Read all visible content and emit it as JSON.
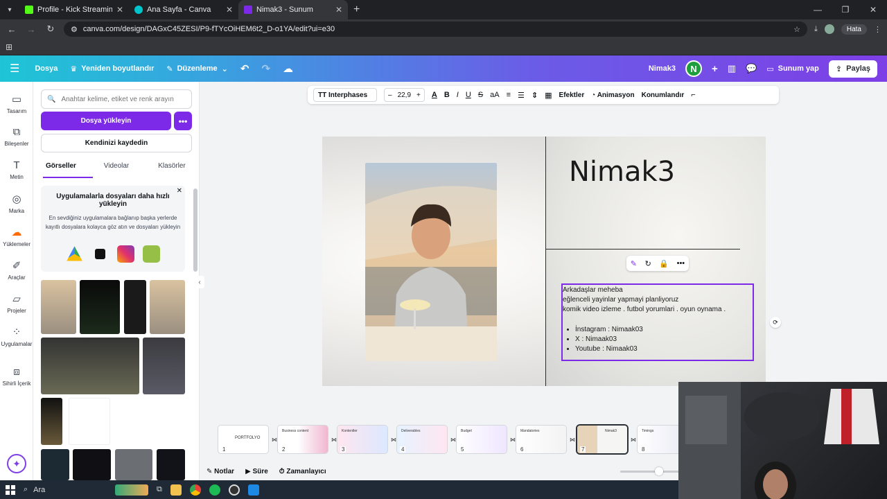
{
  "browser": {
    "tabs": [
      {
        "title": "Profile - Kick Streaming",
        "color": "#53fc18"
      },
      {
        "title": "Ana Sayfa - Canva",
        "color": "#00c4cc"
      },
      {
        "title": "Nimak3 - Sunum",
        "color": "#7d2ae8"
      }
    ],
    "url": "canva.com/design/DAGxC45ZESI/P9-fTYcOiHEM6t2_D-o1YA/edit?ui=e30",
    "error_label": "Hata"
  },
  "header": {
    "file": "Dosya",
    "resize": "Yeniden boyutlandır",
    "edit": "Düzenleme",
    "doc_name": "Nimak3",
    "user_initial": "N",
    "present": "Sunum yap",
    "share": "Paylaş"
  },
  "rail": [
    {
      "label": "Tasarım",
      "icon": "layout-icon"
    },
    {
      "label": "Bileşenler",
      "icon": "elements-icon"
    },
    {
      "label": "Metin",
      "icon": "text-icon"
    },
    {
      "label": "Marka",
      "icon": "brand-icon"
    },
    {
      "label": "Yüklemeler",
      "icon": "upload-icon"
    },
    {
      "label": "Araçlar",
      "icon": "tools-icon"
    },
    {
      "label": "Projeler",
      "icon": "folder-icon"
    },
    {
      "label": "Uygulamalar",
      "icon": "apps-icon"
    },
    {
      "label": "Sihirli İçerik",
      "icon": "magic-icon"
    }
  ],
  "panel": {
    "search_placeholder": "Anahtar kelime, etiket ve renk arayın",
    "upload_button": "Dosya yükleyin",
    "record_button": "Kendinizi kaydedin",
    "tabs": [
      "Görseller",
      "Videolar",
      "Klasörler"
    ],
    "promo_title": "Uygulamalarla dosyaları daha hızlı yükleyin",
    "promo_text": "En sevdiğiniz uygulamalara bağlanıp başka yerlerde kayıtlı dosyalara kolayca göz atın ve dosyaları yükleyin"
  },
  "toolbar": {
    "font": "TT Interphases",
    "size": "22,9",
    "effects": "Efektler",
    "animation": "Animasyon",
    "position": "Konumlandır"
  },
  "slide": {
    "title": "Nimak3",
    "lines": [
      "Arkadaşlar meheba",
      "eğlenceli yayinlar yapmayi planliyoruz",
      "komik video izleme . futbol yorumlari . oyun oynama ."
    ],
    "bullets": [
      "İnstagram : Nimaak03",
      "X : Nimaak03",
      "Youtube : Nimaak03"
    ]
  },
  "pages": [
    {
      "num": "1",
      "label": "PORTFOLYO"
    },
    {
      "num": "2",
      "label": "Business content"
    },
    {
      "num": "3",
      "label": "Kontentler"
    },
    {
      "num": "4",
      "label": "Deliverables"
    },
    {
      "num": "5",
      "label": "Budget"
    },
    {
      "num": "6",
      "label": "Mandatories"
    },
    {
      "num": "7",
      "label": "Nimak3"
    },
    {
      "num": "8",
      "label": "Timings"
    }
  ],
  "bottom": {
    "notes": "Notlar",
    "duration": "Süre",
    "timer": "Zamanlayıcı"
  },
  "taskbar": {
    "search": "Ara"
  }
}
